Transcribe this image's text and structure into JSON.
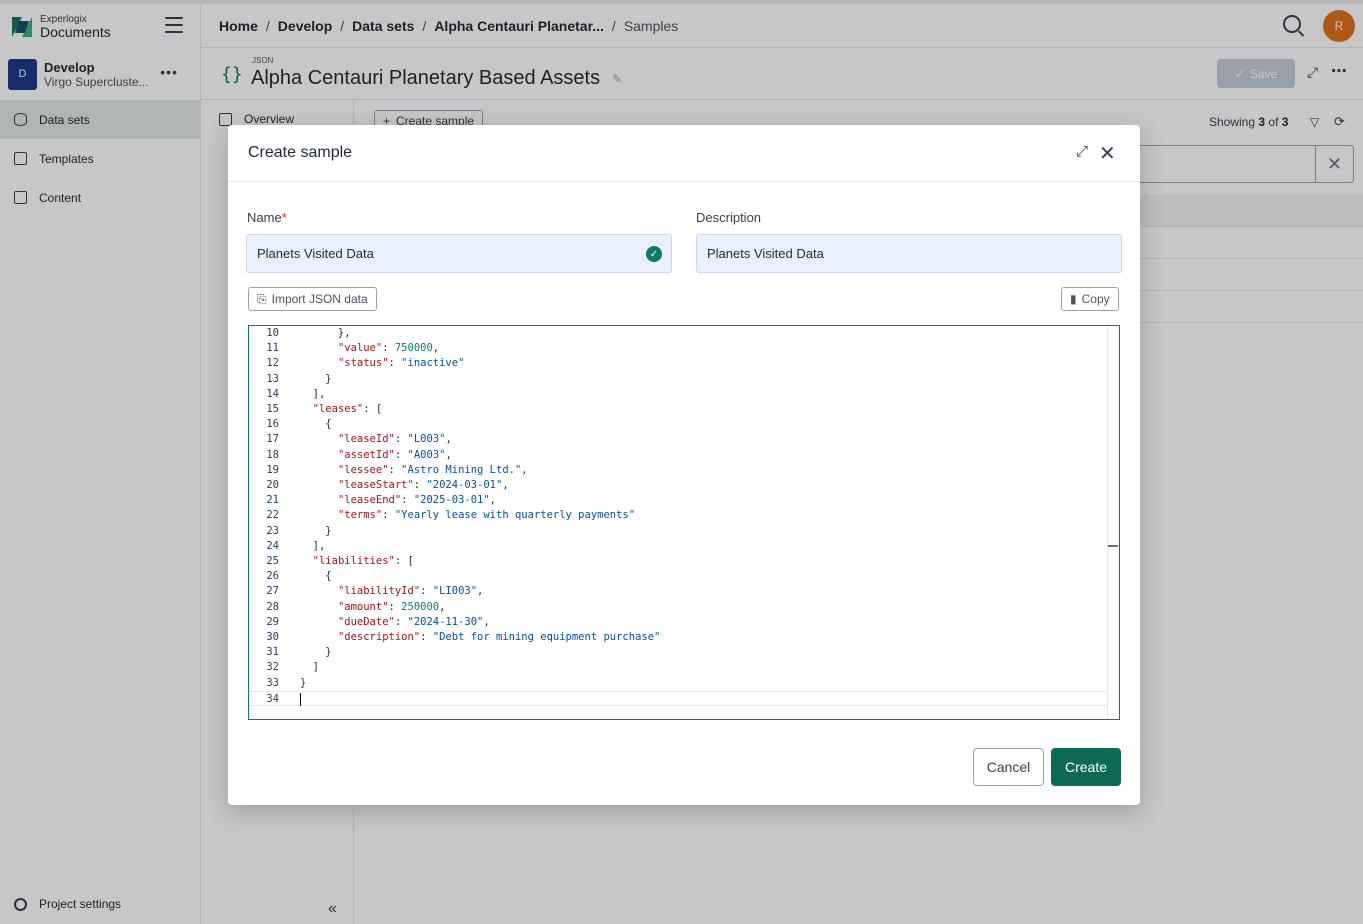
{
  "app": {
    "brand_small": "Experlogix",
    "brand_large": "Documents"
  },
  "project": {
    "avatar_letter": "D",
    "name": "Develop",
    "subtitle": "Virgo Supercluste..."
  },
  "sidebar": {
    "items": [
      {
        "label": "Data sets",
        "icon": "database-icon",
        "active": true
      },
      {
        "label": "Templates",
        "icon": "file-icon",
        "active": false
      },
      {
        "label": "Content",
        "icon": "content-icon",
        "active": false
      }
    ],
    "settings_label": "Project settings"
  },
  "breadcrumb": {
    "items": [
      "Home",
      "Develop",
      "Data sets",
      "Alpha Centauri Planetar..."
    ],
    "current": "Samples"
  },
  "user": {
    "initial": "R",
    "color": "#e0701e"
  },
  "page": {
    "type_label": "JSON",
    "title": "Alpha Centauri Planetary Based Assets",
    "save_label": "Save"
  },
  "subnav": {
    "overview_label": "Overview"
  },
  "samples_list": {
    "create_label": "Create sample",
    "showing_prefix": "Showing",
    "showing_count": "3",
    "showing_of": "of",
    "showing_total": "3"
  },
  "modal": {
    "title": "Create sample",
    "name_label": "Name",
    "required_mark": "*",
    "name_value": "Planets Visited Data",
    "description_label": "Description",
    "description_value": "Planets Visited Data",
    "import_label": "Import JSON data",
    "copy_label": "Copy",
    "cancel_label": "Cancel",
    "create_label": "Create"
  },
  "editor": {
    "lines": [
      {
        "n": "10",
        "parts": [
          [
            "p",
            "      },"
          ]
        ]
      },
      {
        "n": "11",
        "parts": [
          [
            "p",
            "      "
          ],
          [
            "k",
            "\"value\""
          ],
          [
            "p",
            ": "
          ],
          [
            "n",
            "750000"
          ],
          [
            "p",
            ","
          ]
        ]
      },
      {
        "n": "12",
        "parts": [
          [
            "p",
            "      "
          ],
          [
            "k",
            "\"status\""
          ],
          [
            "p",
            ": "
          ],
          [
            "s",
            "\"inactive\""
          ]
        ]
      },
      {
        "n": "13",
        "parts": [
          [
            "p",
            "    }"
          ]
        ]
      },
      {
        "n": "14",
        "parts": [
          [
            "p",
            "  ],"
          ]
        ]
      },
      {
        "n": "15",
        "parts": [
          [
            "p",
            "  "
          ],
          [
            "k",
            "\"leases\""
          ],
          [
            "p",
            ": ["
          ]
        ]
      },
      {
        "n": "16",
        "parts": [
          [
            "p",
            "    {"
          ]
        ]
      },
      {
        "n": "17",
        "parts": [
          [
            "p",
            "      "
          ],
          [
            "k",
            "\"leaseId\""
          ],
          [
            "p",
            ": "
          ],
          [
            "s",
            "\"L003\""
          ],
          [
            "p",
            ","
          ]
        ]
      },
      {
        "n": "18",
        "parts": [
          [
            "p",
            "      "
          ],
          [
            "k",
            "\"assetId\""
          ],
          [
            "p",
            ": "
          ],
          [
            "s",
            "\"A003\""
          ],
          [
            "p",
            ","
          ]
        ]
      },
      {
        "n": "19",
        "parts": [
          [
            "p",
            "      "
          ],
          [
            "k",
            "\"lessee\""
          ],
          [
            "p",
            ": "
          ],
          [
            "s",
            "\"Astro Mining Ltd.\""
          ],
          [
            "p",
            ","
          ]
        ]
      },
      {
        "n": "20",
        "parts": [
          [
            "p",
            "      "
          ],
          [
            "k",
            "\"leaseStart\""
          ],
          [
            "p",
            ": "
          ],
          [
            "s",
            "\"2024-03-01\""
          ],
          [
            "p",
            ","
          ]
        ]
      },
      {
        "n": "21",
        "parts": [
          [
            "p",
            "      "
          ],
          [
            "k",
            "\"leaseEnd\""
          ],
          [
            "p",
            ": "
          ],
          [
            "s",
            "\"2025-03-01\""
          ],
          [
            "p",
            ","
          ]
        ]
      },
      {
        "n": "22",
        "parts": [
          [
            "p",
            "      "
          ],
          [
            "k",
            "\"terms\""
          ],
          [
            "p",
            ": "
          ],
          [
            "s",
            "\"Yearly lease with quarterly payments\""
          ]
        ]
      },
      {
        "n": "23",
        "parts": [
          [
            "p",
            "    }"
          ]
        ]
      },
      {
        "n": "24",
        "parts": [
          [
            "p",
            "  ],"
          ]
        ]
      },
      {
        "n": "25",
        "parts": [
          [
            "p",
            "  "
          ],
          [
            "k",
            "\"liabilities\""
          ],
          [
            "p",
            ": ["
          ]
        ]
      },
      {
        "n": "26",
        "parts": [
          [
            "p",
            "    {"
          ]
        ]
      },
      {
        "n": "27",
        "parts": [
          [
            "p",
            "      "
          ],
          [
            "k",
            "\"liabilityId\""
          ],
          [
            "p",
            ": "
          ],
          [
            "s",
            "\"LI003\""
          ],
          [
            "p",
            ","
          ]
        ]
      },
      {
        "n": "28",
        "parts": [
          [
            "p",
            "      "
          ],
          [
            "k",
            "\"amount\""
          ],
          [
            "p",
            ": "
          ],
          [
            "n",
            "250000"
          ],
          [
            "p",
            ","
          ]
        ]
      },
      {
        "n": "29",
        "parts": [
          [
            "p",
            "      "
          ],
          [
            "k",
            "\"dueDate\""
          ],
          [
            "p",
            ": "
          ],
          [
            "s",
            "\"2024-11-30\""
          ],
          [
            "p",
            ","
          ]
        ]
      },
      {
        "n": "30",
        "parts": [
          [
            "p",
            "      "
          ],
          [
            "k",
            "\"description\""
          ],
          [
            "p",
            ": "
          ],
          [
            "s",
            "\"Debt for mining equipment purchase\""
          ]
        ]
      },
      {
        "n": "31",
        "parts": [
          [
            "p",
            "    }"
          ]
        ]
      },
      {
        "n": "32",
        "parts": [
          [
            "p",
            "  ]"
          ]
        ]
      },
      {
        "n": "33",
        "parts": [
          [
            "p",
            "}"
          ]
        ]
      },
      {
        "n": "34",
        "parts": [
          [
            "p",
            ""
          ]
        ]
      }
    ]
  },
  "colors": {
    "accent": "#0d6b55",
    "json_key": "#a31515",
    "json_string": "#0451a5",
    "json_number": "#098658"
  }
}
